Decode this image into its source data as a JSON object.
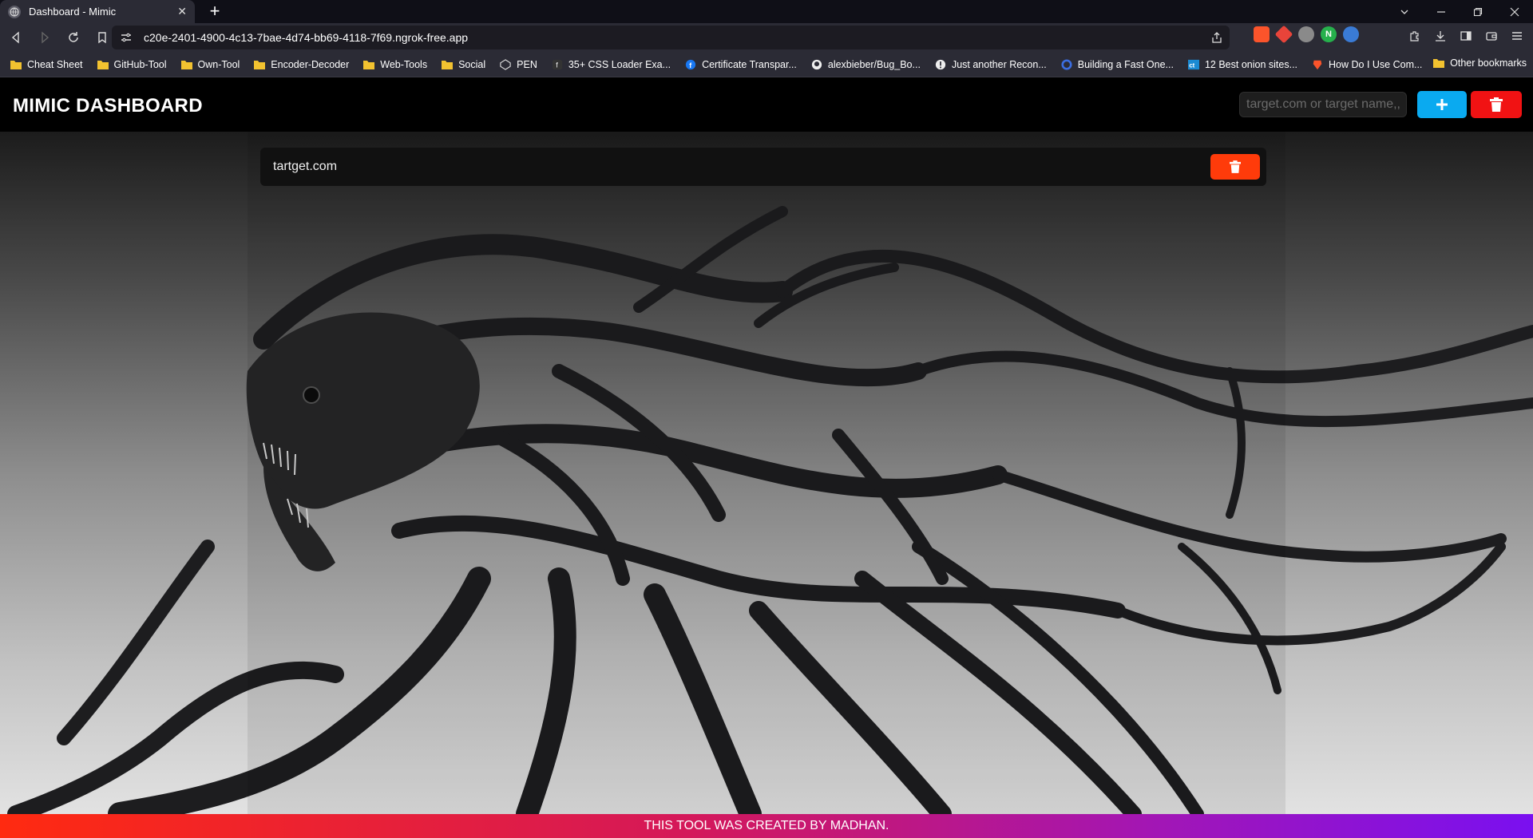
{
  "browser": {
    "tab_title": "Dashboard - Mimic",
    "tab_close": "✕",
    "new_tab": "+",
    "url": "c20e-2401-4900-4c13-7bae-4d74-bb69-4118-7f69.ngrok-free.app",
    "bookmarks": [
      {
        "label": "Cheat Sheet",
        "icon": "folder-icon"
      },
      {
        "label": "GitHub-Tool",
        "icon": "folder-icon"
      },
      {
        "label": "Own-Tool",
        "icon": "folder-icon"
      },
      {
        "label": "Encoder-Decoder",
        "icon": "folder-icon"
      },
      {
        "label": "Web-Tools",
        "icon": "folder-icon"
      },
      {
        "label": "Social",
        "icon": "folder-icon"
      },
      {
        "label": "PEN",
        "icon": "codepen-icon"
      },
      {
        "label": "35+ CSS Loader Exa...",
        "icon": "f-icon"
      },
      {
        "label": "Certificate Transpar...",
        "icon": "facebook-icon"
      },
      {
        "label": "alexbieber/Bug_Bo...",
        "icon": "github-icon"
      },
      {
        "label": "Just another Recon...",
        "icon": "exclamation-icon"
      },
      {
        "label": "Building a Fast One...",
        "icon": "swirl-icon"
      },
      {
        "label": "12 Best onion sites...",
        "icon": "ct-icon"
      },
      {
        "label": "How Do I Use Com...",
        "icon": "brave-icon"
      }
    ],
    "other_bookmarks": "Other bookmarks",
    "extensions": [
      {
        "name": "brave-shield-icon",
        "text": "",
        "color": "#fb542b"
      },
      {
        "name": "rewards-icon",
        "text": "",
        "color": "#e8443a"
      },
      {
        "name": "circle-ext-icon",
        "text": "",
        "color": "#8a8a8a"
      },
      {
        "name": "n-ext-icon",
        "text": "N",
        "color": "#26b04c"
      },
      {
        "name": "glasses-ext-icon",
        "text": "",
        "color": "#3a7bd5"
      }
    ]
  },
  "app": {
    "title": "MIMIC DASHBOARD",
    "input_placeholder": "target.com or target name,,",
    "targets": [
      {
        "name": "tartget.com"
      }
    ],
    "footer": "THIS TOOL WAS CREATED BY MADHAN."
  },
  "colors": {
    "add_button": "#0aaaf0",
    "delete_all_button": "#f11213",
    "card_delete_button": "#ff3b0a"
  }
}
